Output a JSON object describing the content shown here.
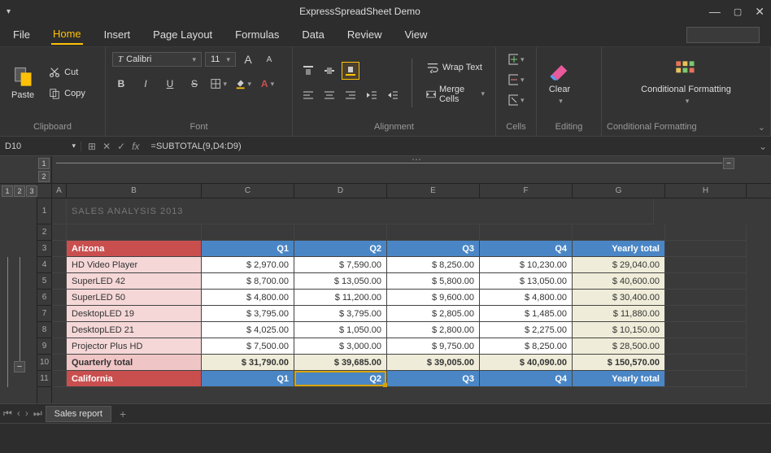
{
  "app": {
    "title": "ExpressSpreadSheet Demo"
  },
  "menu": {
    "file": "File",
    "home": "Home",
    "insert": "Insert",
    "page_layout": "Page Layout",
    "formulas": "Formulas",
    "data": "Data",
    "review": "Review",
    "view": "View"
  },
  "ribbon": {
    "clipboard": {
      "paste": "Paste",
      "cut": "Cut",
      "copy": "Copy",
      "label": "Clipboard"
    },
    "font": {
      "name": "Calibri",
      "size": "11",
      "label": "Font"
    },
    "alignment": {
      "wrap": "Wrap Text",
      "merge": "Merge Cells",
      "label": "Alignment"
    },
    "cells": {
      "label": "Cells"
    },
    "editing": {
      "clear": "Clear",
      "label": "Editing"
    },
    "cf": {
      "btn": "Conditional Formatting",
      "label": "Conditional Formatting"
    }
  },
  "formula": {
    "cell": "D10",
    "fx": "fx",
    "text": "=SUBTOTAL(9,D4:D9)"
  },
  "outline": {
    "col_levels": [
      "1",
      "2"
    ],
    "row_levels": [
      "1",
      "2",
      "3"
    ]
  },
  "columns": [
    "A",
    "B",
    "C",
    "D",
    "E",
    "F",
    "G",
    "H"
  ],
  "row_nums": [
    "1",
    "2",
    "3",
    "4",
    "5",
    "6",
    "7",
    "8",
    "9",
    "10",
    "11"
  ],
  "sheet": {
    "title": "SALES ANALYSIS 2013",
    "headers": {
      "region": "Arizona",
      "q1": "Q1",
      "q2": "Q2",
      "q3": "Q3",
      "q4": "Q4",
      "total": "Yearly total"
    },
    "rows": [
      {
        "name": "HD Video Player",
        "q1": "$ 2,970.00",
        "q2": "$ 7,590.00",
        "q3": "$ 8,250.00",
        "q4": "$ 10,230.00",
        "total": "$ 29,040.00"
      },
      {
        "name": "SuperLED 42",
        "q1": "$ 8,700.00",
        "q2": "$ 13,050.00",
        "q3": "$ 5,800.00",
        "q4": "$ 13,050.00",
        "total": "$ 40,600.00"
      },
      {
        "name": "SuperLED 50",
        "q1": "$ 4,800.00",
        "q2": "$ 11,200.00",
        "q3": "$ 9,600.00",
        "q4": "$ 4,800.00",
        "total": "$ 30,400.00"
      },
      {
        "name": "DesktopLED 19",
        "q1": "$ 3,795.00",
        "q2": "$ 3,795.00",
        "q3": "$ 2,805.00",
        "q4": "$ 1,485.00",
        "total": "$ 11,880.00"
      },
      {
        "name": "DesktopLED 21",
        "q1": "$ 4,025.00",
        "q2": "$ 1,050.00",
        "q3": "$ 2,800.00",
        "q4": "$ 2,275.00",
        "total": "$ 10,150.00"
      },
      {
        "name": "Projector Plus HD",
        "q1": "$ 7,500.00",
        "q2": "$ 3,000.00",
        "q3": "$ 9,750.00",
        "q4": "$ 8,250.00",
        "total": "$ 28,500.00"
      }
    ],
    "quarterly": {
      "name": "Quarterly total",
      "q1": "$ 31,790.00",
      "q2": "$ 39,685.00",
      "q3": "$ 39,005.00",
      "q4": "$ 40,090.00",
      "total": "$ 150,570.00"
    },
    "headers2": {
      "region": "California",
      "q1": "Q1",
      "q2": "Q2",
      "q3": "Q3",
      "q4": "Q4",
      "total": "Yearly total"
    }
  },
  "tabs": {
    "sheet": "Sales report"
  }
}
